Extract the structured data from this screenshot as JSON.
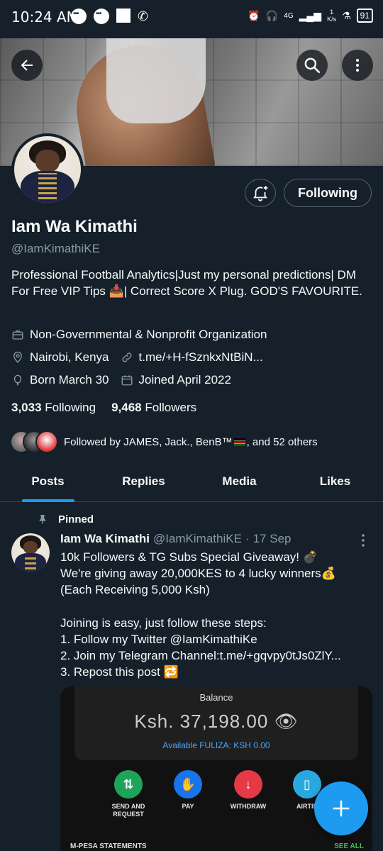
{
  "status_bar": {
    "time": "10:24 AM",
    "network": "4G",
    "speed_value": "1",
    "speed_unit": "K/s",
    "battery": "91"
  },
  "header": {
    "back_icon": "back-arrow-icon",
    "search_icon": "search-icon",
    "more_icon": "more-vertical-icon"
  },
  "profile": {
    "name": "Iam Wa Kimathi",
    "handle": "@IamKimathiKE",
    "bio": "Professional Football Analytics|Just my personal predictions| DM For Free VIP Tips 📥| Correct Score X Plug. GOD'S FAVOURITE.",
    "category": "Non-Governmental & Nonprofit Organization",
    "location": "Nairobi, Kenya",
    "link": "t.me/+H-fSznkxNtBiN...",
    "born": "Born March 30",
    "joined": "Joined April 2022",
    "following_count": "3,033",
    "following_label": "Following",
    "followers_count": "9,468",
    "followers_label": "Followers",
    "followed_by_prefix": "Followed by JAMES, Jack., BenB™",
    "followed_by_suffix": ", and 52 others",
    "following_button": "Following"
  },
  "tabs": [
    "Posts",
    "Replies",
    "Media",
    "Likes"
  ],
  "active_tab": "Posts",
  "pinned_post": {
    "pinned_label": "Pinned",
    "author": "Iam Wa Kimathi",
    "handle": "@IamKimathiKE",
    "separator": "·",
    "date": "17 Sep",
    "text": "10k  Followers & TG Subs  Special Giveaway! 💣\nWe're giving away 20,000KES  to 4 lucky winners💰\n(Each Receiving 5,000 Ksh)\n\nJoining is easy, just follow these steps:\n1. Follow my Twitter @IamKimathiKe\n2. Join my Telegram Channel:t.me/+gqvpy0tJs0ZlY...\n3. Repost this post 🔁",
    "media": {
      "balance_label": "Balance",
      "balance_amount": "Ksh. 37,198.00",
      "fuliza": "Available FULIZA: KSH 0.00",
      "actions": [
        {
          "line1": "SEND AND",
          "line2": "REQUEST",
          "color": "#1ea35b"
        },
        {
          "line1": "PAY",
          "line2": "",
          "color": "#1a73e8"
        },
        {
          "line1": "WITHDRAW",
          "line2": "",
          "color": "#e53945"
        },
        {
          "line1": "AIRTIN",
          "line2": "",
          "color": "#29a8e0"
        }
      ],
      "statements": "M-PESA STATEMENTS",
      "see_all": "SEE ALL"
    }
  },
  "colors": {
    "background": "#15202b",
    "accent": "#1d9bf0",
    "muted": "#8b98a5",
    "border": "#38444d"
  }
}
